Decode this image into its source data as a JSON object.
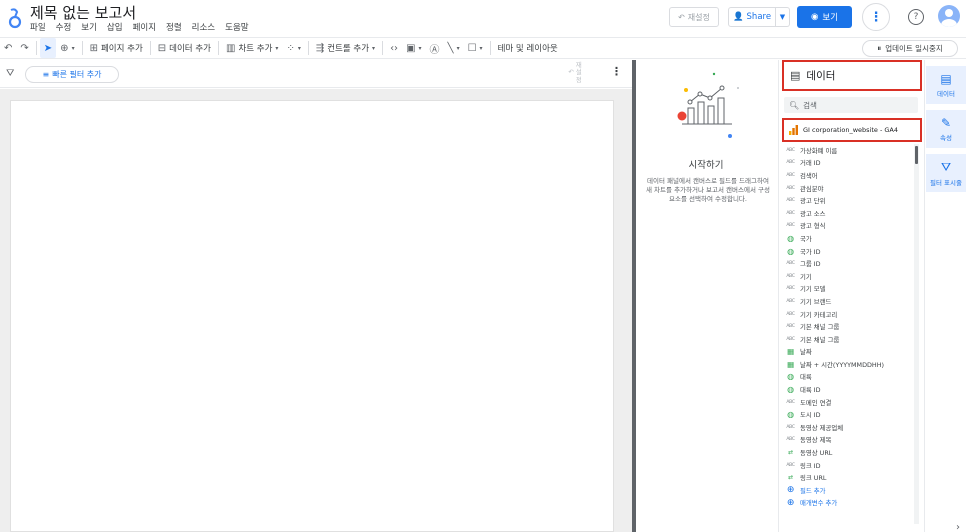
{
  "title_bar": {
    "doc_title": "제목 없는 보고서",
    "menu": [
      "파일",
      "수정",
      "보기",
      "삽입",
      "페이지",
      "정렬",
      "리소스",
      "도움말"
    ],
    "reset_label": "재설정",
    "share_label": "Share",
    "view_label": "보기",
    "help_glyph": "?"
  },
  "toolbar": {
    "add_page": "페이지 추가",
    "add_data": "데이터 추가",
    "add_chart": "차트 추가",
    "add_control": "컨트롤 추가",
    "theme_layout": "테마 및 레이아웃",
    "pause_updates": "업데이트 일시중지"
  },
  "filter_bar": {
    "quick_filter": "빠른 필터 추가",
    "reset_vertical": "재\n설\n정"
  },
  "getting_started": {
    "title": "시작하기",
    "text": "데이터 패널에서 캔버스로 필드를 드래그하여 새 차트를 추가하거나 보고서 캔버스에서 구성요소를 선택하여 수정합니다."
  },
  "data_panel": {
    "header": "데이터",
    "search_placeholder": "검색",
    "source_name": "GI corporation_website - GA4",
    "fields": [
      {
        "type": "ABC",
        "name": "가상화폐 이름"
      },
      {
        "type": "ABC",
        "name": "거래 ID"
      },
      {
        "type": "ABC",
        "name": "검색어"
      },
      {
        "type": "ABC",
        "name": "관심분야"
      },
      {
        "type": "ABC",
        "name": "광고 단위"
      },
      {
        "type": "ABC",
        "name": "광고 소스"
      },
      {
        "type": "ABC",
        "name": "광고 형식"
      },
      {
        "type": "GEO",
        "name": "국가"
      },
      {
        "type": "GEO",
        "name": "국가 ID"
      },
      {
        "type": "ABC",
        "name": "그룹 ID"
      },
      {
        "type": "ABC",
        "name": "기기"
      },
      {
        "type": "ABC",
        "name": "기기 모델"
      },
      {
        "type": "ABC",
        "name": "기기 브랜드"
      },
      {
        "type": "ABC",
        "name": "기기 카테고리"
      },
      {
        "type": "ABC",
        "name": "기본 채널 그룹"
      },
      {
        "type": "ABC",
        "name": "기본 채널 그룹"
      },
      {
        "type": "DATE",
        "name": "날짜"
      },
      {
        "type": "DATE",
        "name": "날짜 + 시간(YYYYMMDDHH)"
      },
      {
        "type": "GEO",
        "name": "대륙"
      },
      {
        "type": "GEO",
        "name": "대륙 ID"
      },
      {
        "type": "ABC",
        "name": "도메인 연결"
      },
      {
        "type": "GEO",
        "name": "도시 ID"
      },
      {
        "type": "ABC",
        "name": "동영상 제공업체"
      },
      {
        "type": "ABC",
        "name": "동영상 제목"
      },
      {
        "type": "URL",
        "name": "동영상 URL"
      },
      {
        "type": "ABC",
        "name": "링크 ID"
      },
      {
        "type": "URL",
        "name": "링크 URL"
      }
    ],
    "add_field": "필드 추가",
    "add_parameter": "매개변수 추가"
  },
  "right_rail": {
    "data": "데이터",
    "properties": "속성",
    "filter": "필터 표시줄"
  },
  "colors": {
    "accent": "#1a73e8",
    "highlight_border": "#d93025",
    "canvas_bg": "#eeeeee"
  }
}
